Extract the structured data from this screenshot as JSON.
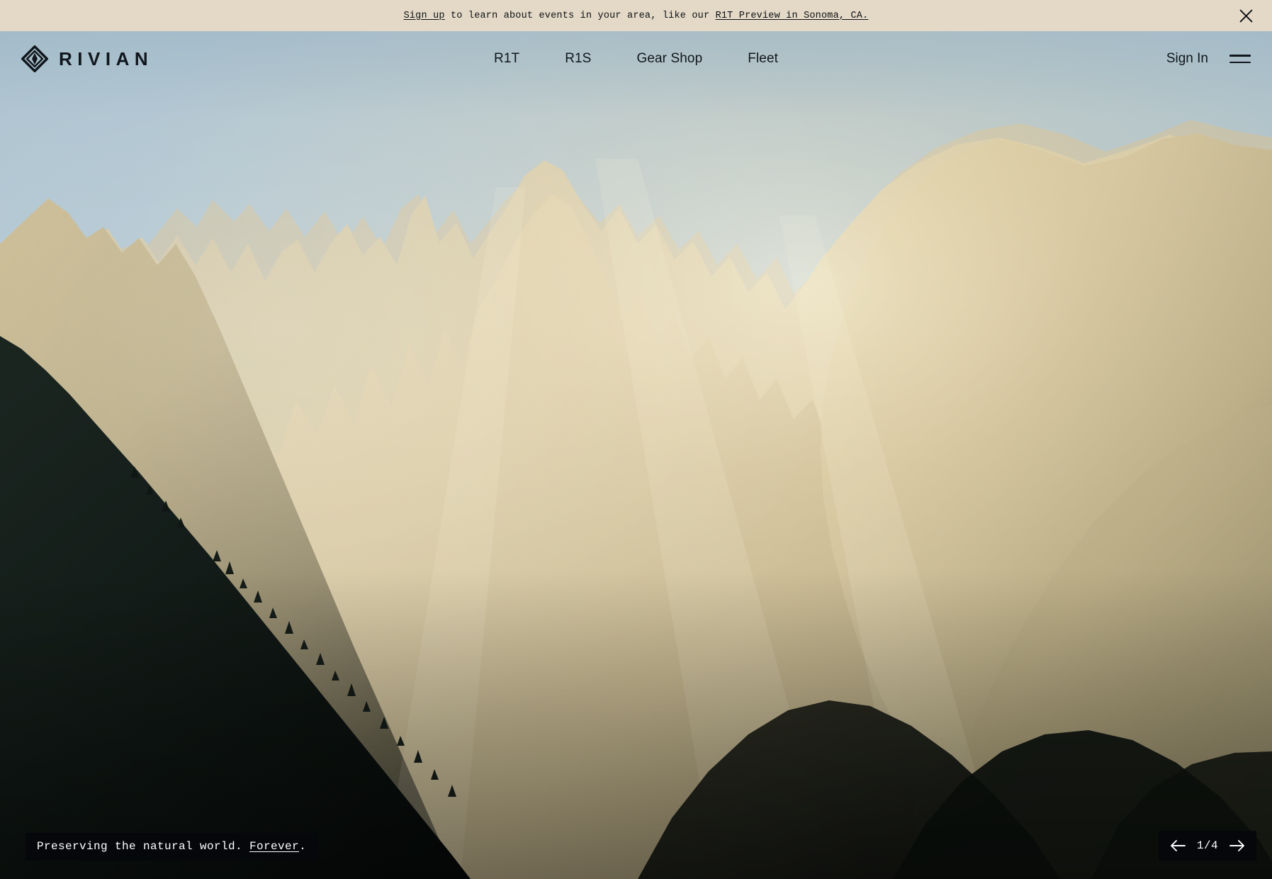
{
  "promo_banner": {
    "link_primary": "Sign up",
    "text_middle": " to learn about events in your area, like our ",
    "link_secondary": "R1T Preview in Sonoma, CA.",
    "close_icon": "close-icon",
    "background_color": "#e4d9c6",
    "text_color": "#0d1116"
  },
  "header": {
    "logo_wordmark": "RIVIAN",
    "logo_icon": "rivian-diamond-logo-icon",
    "nav_items": [
      {
        "label": "R1T"
      },
      {
        "label": "R1S"
      },
      {
        "label": "Gear Shop"
      },
      {
        "label": "Fleet"
      }
    ],
    "sign_in_label": "Sign In",
    "menu_icon": "hamburger-menu-icon",
    "text_color": "#10161c"
  },
  "hero": {
    "caption_text": "Preserving the natural world. ",
    "caption_link": "Forever",
    "caption_suffix": ".",
    "caption_background": "#05070a",
    "caption_text_color": "#ffffff",
    "sky_color": "#a5bdcb",
    "mountain_highlight_color": "#d8c79b",
    "mountain_shadow_color": "#0d1410"
  },
  "carousel": {
    "prev_icon": "arrow-left-icon",
    "next_icon": "arrow-right-icon",
    "counter": "1/4",
    "current_slide": 1,
    "total_slides": 4,
    "background": "#05070a"
  }
}
